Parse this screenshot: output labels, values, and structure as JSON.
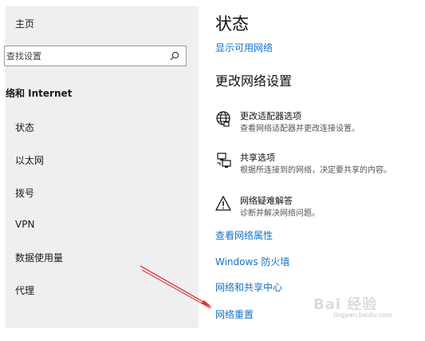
{
  "sidebar": {
    "home_label": "主页",
    "search_placeholder": "查找设置",
    "section_title": "络和 Internet",
    "items": [
      {
        "label": "状态"
      },
      {
        "label": "以太网"
      },
      {
        "label": "拨号"
      },
      {
        "label": "VPN"
      },
      {
        "label": "数据使用量"
      },
      {
        "label": "代理"
      }
    ]
  },
  "main": {
    "title": "状态",
    "show_networks_link": "显示可用网络",
    "change_heading": "更改网络设置",
    "options": [
      {
        "title": "更改适配器选项",
        "desc": "查看网络适配器并更改连接设置。",
        "icon": "globe-icon"
      },
      {
        "title": "共享选项",
        "desc": "根据所连接到的网络，决定要共享的内容。",
        "icon": "sharing-icon"
      },
      {
        "title": "网络疑难解答",
        "desc": "诊断并解决网络问题。",
        "icon": "warning-icon"
      }
    ],
    "links": [
      {
        "label": "查看网络属性"
      },
      {
        "label": "Windows 防火墙"
      },
      {
        "label": "网络和共享中心"
      },
      {
        "label": "网络重置"
      }
    ]
  },
  "watermark": {
    "text": "Bai 经验",
    "sub": "jingyan.baidu.com"
  },
  "colors": {
    "link": "#1473c6",
    "sidebar_bg": "#efefef",
    "annotation_arrow": "#d8373a"
  }
}
